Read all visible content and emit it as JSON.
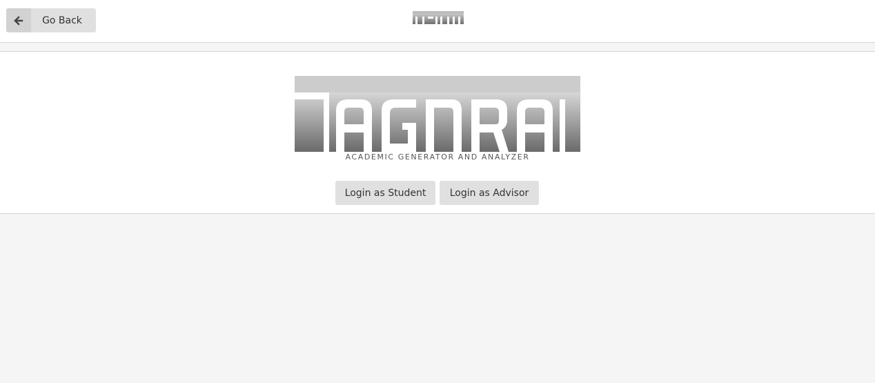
{
  "header": {
    "back_label": "Go Back",
    "back_icon": "arrow-left-icon",
    "small_logo_text": "TAGNRA"
  },
  "brand": {
    "logo_text": "TAGNRA",
    "tagline": "ACADEMIC GENERATOR AND ANALYZER"
  },
  "actions": {
    "student_label": "Login as Student",
    "advisor_label": "Login as Advisor"
  },
  "colors": {
    "button_bg": "#e0e0e0",
    "page_bg": "#f5f5f5"
  }
}
